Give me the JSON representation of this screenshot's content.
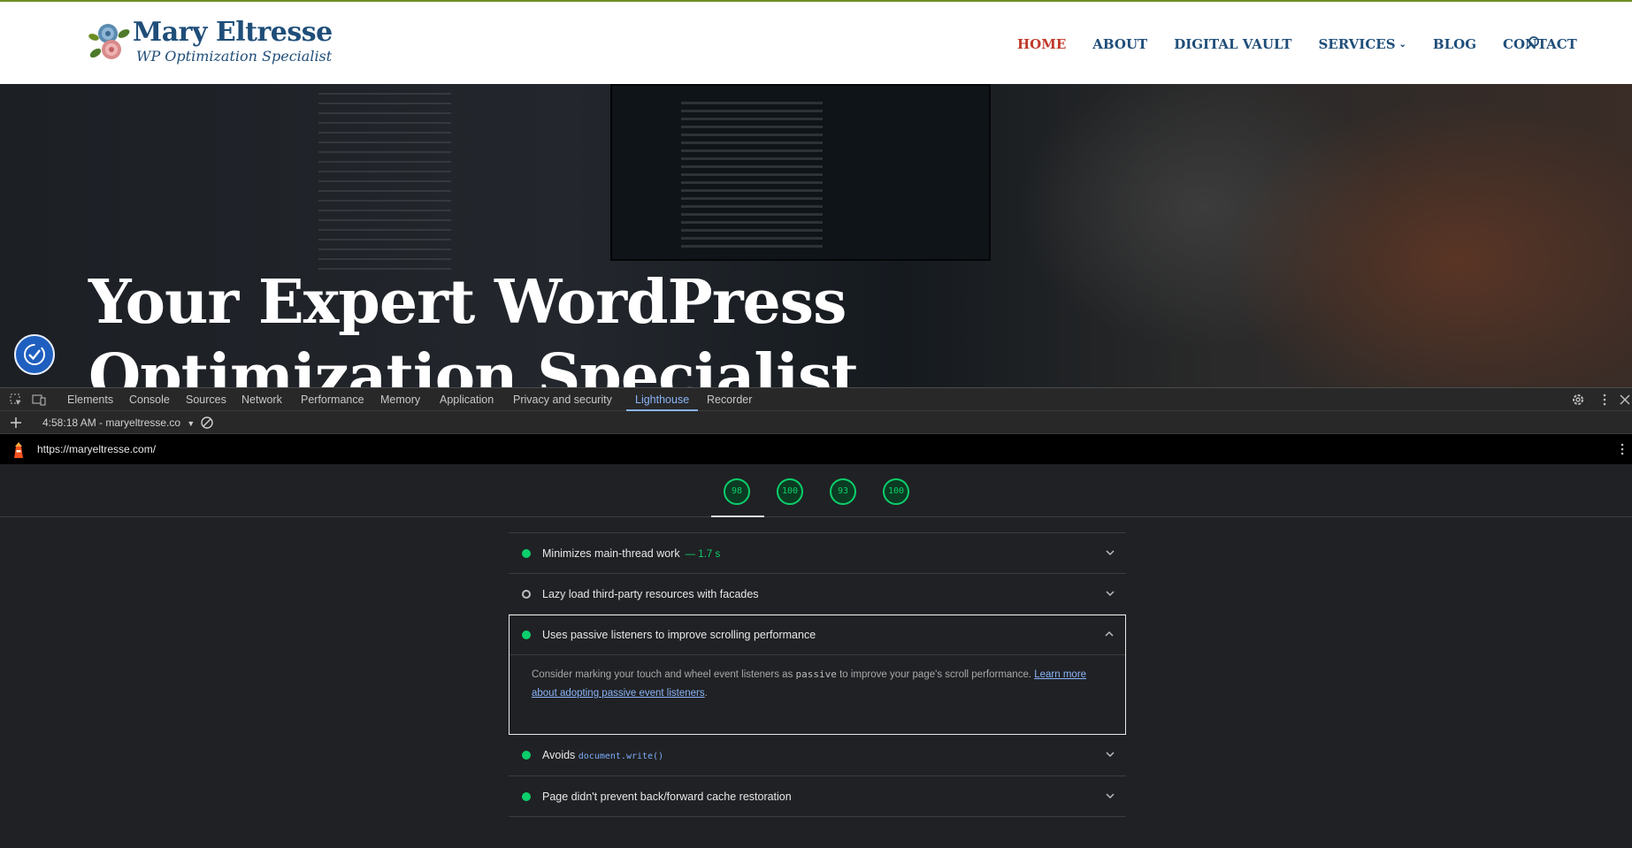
{
  "site": {
    "logo_name": "Mary Eltresse",
    "logo_tagline": "WP Optimization Specialist",
    "nav": [
      {
        "label": "HOME",
        "active": true
      },
      {
        "label": "ABOUT",
        "active": false
      },
      {
        "label": "DIGITAL VAULT",
        "active": false
      },
      {
        "label": "SERVICES",
        "active": false,
        "has_dropdown": true
      },
      {
        "label": "BLOG",
        "active": false
      },
      {
        "label": "CONTACT",
        "active": false
      }
    ],
    "hero_line1": "Your Expert WordPress",
    "hero_line2": "Optimization Specialist",
    "colors": {
      "nav_text": "#1f4e79",
      "nav_active": "#c0392b"
    }
  },
  "devtools": {
    "tabs": [
      "Elements",
      "Console",
      "Sources",
      "Network",
      "Performance",
      "Memory",
      "Application",
      "Privacy and security",
      "Lighthouse",
      "Recorder"
    ],
    "active_tab": "Lighthouse",
    "report_label": "4:58:18 AM - maryeltresse.co",
    "url": "https://maryeltresse.com/",
    "scores": [
      "98",
      "100",
      "93",
      "100"
    ],
    "colors": {
      "pass": "#0cce6b",
      "link": "#8ab4f8"
    }
  },
  "audits": [
    {
      "title": "Minimizes main-thread work",
      "value": "— 1.7 s",
      "status": "pass"
    },
    {
      "title": "Lazy load third-party resources with facades",
      "status": "neutral"
    },
    {
      "title": "Uses passive listeners to improve scrolling performance",
      "status": "pass",
      "expanded": true,
      "desc_before": "Consider marking your touch and wheel event listeners as ",
      "desc_code": "passive",
      "desc_after": " to improve your page's scroll performance. ",
      "desc_link": "Learn more about adopting passive event listeners",
      "desc_end": "."
    },
    {
      "title_prefix": "Avoids ",
      "title_code": "document.write()",
      "status": "pass"
    },
    {
      "title": "Page didn't prevent back/forward cache restoration",
      "status": "pass"
    }
  ]
}
